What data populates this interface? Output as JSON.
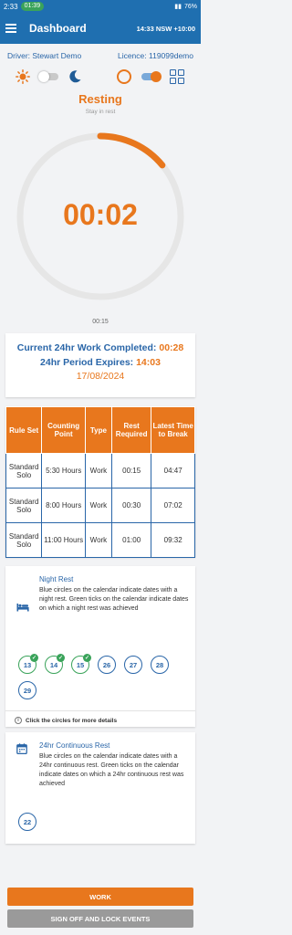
{
  "status_bar": {
    "time": "2:33",
    "call": "01:39",
    "battery": "76%"
  },
  "app_bar": {
    "title": "Dashboard",
    "time": "14:33 NSW +10:00"
  },
  "driver": {
    "label": "Driver: Stewart Demo",
    "licence": "Licence: 119099demo"
  },
  "state": {
    "title": "Resting",
    "subtitle": "Stay in rest",
    "timer": "00:02",
    "elapsed": "00:15",
    "dial_progress": 0.14
  },
  "summary": {
    "work_label": "Current 24hr Work Completed:",
    "work_value": "00:28",
    "expires_label": "24hr Period Expires:",
    "expires_value": "14:03",
    "date": "17/08/2024"
  },
  "table": {
    "headers": [
      "Rule Set",
      "Counting Point",
      "Type",
      "Rest Required",
      "Latest Time to Break"
    ],
    "rows": [
      [
        "Standard Solo",
        "5:30 Hours",
        "Work",
        "00:15",
        "04:47"
      ],
      [
        "Standard Solo",
        "8:00 Hours",
        "Work",
        "00:30",
        "07:02"
      ],
      [
        "Standard Solo",
        "11:00 Hours",
        "Work",
        "01:00",
        "09:32"
      ]
    ]
  },
  "night_rest": {
    "title": "Night Rest",
    "body": "Blue circles on the calendar indicate dates with a night rest. Green ticks on the calendar indicate dates on which a night rest was achieved",
    "days": [
      "13",
      "14",
      "15",
      "26",
      "27",
      "28",
      "29"
    ],
    "achieved": [
      "13",
      "14",
      "15"
    ],
    "help": "Click the circles for more details"
  },
  "continuous_rest": {
    "title": "24hr Continuous Rest",
    "body": "Blue circles on the calendar indicate dates with a 24hr continuous rest. Green ticks on the calendar indicate dates on which a 24hr continuous rest was achieved",
    "days": [
      "22"
    ]
  },
  "buttons": {
    "work": "WORK",
    "sign_off": "SIGN OFF AND LOCK EVENTS"
  },
  "icons": [
    "menu-icon",
    "sun-icon",
    "moon-icon",
    "ring-icon",
    "grid-icon",
    "bed-icon",
    "calendar-icon",
    "info-icon"
  ],
  "colors": {
    "primary": "#1f6fb0",
    "accent": "#e8771d",
    "success": "#3aa35a"
  }
}
